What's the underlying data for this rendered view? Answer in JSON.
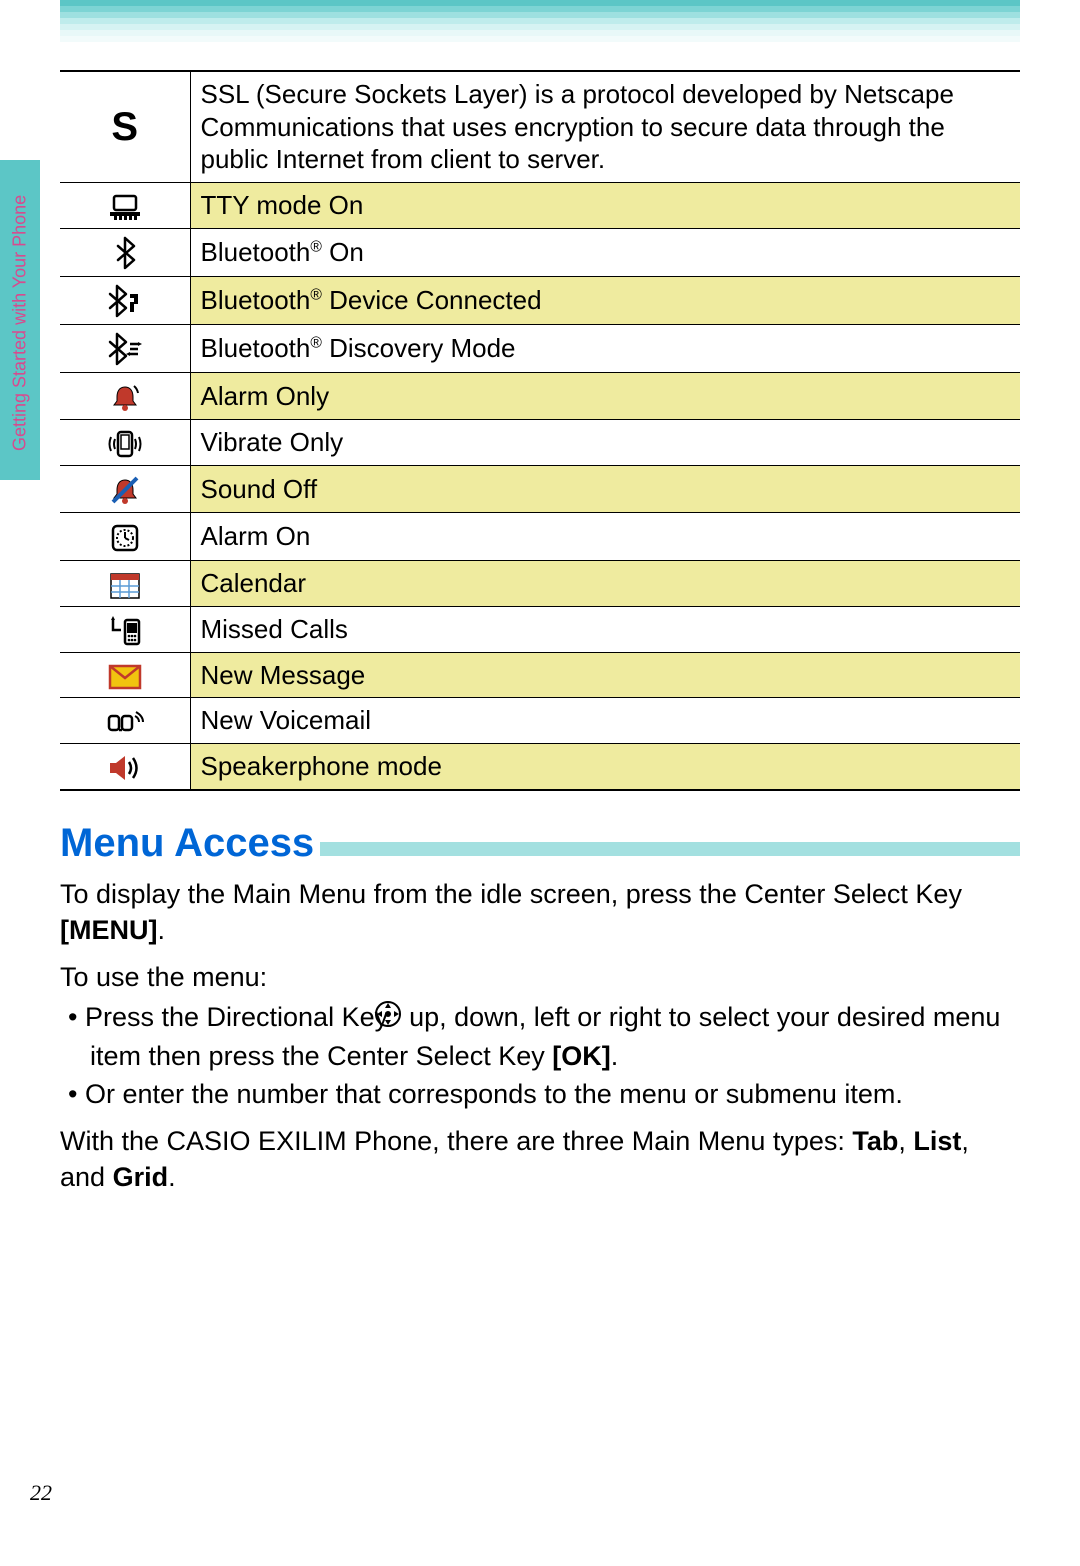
{
  "side_label": "Getting Started with Your Phone",
  "table": {
    "rows": [
      {
        "icon": "ssl-s-icon",
        "desc": "SSL (Secure Sockets Layer) is a protocol developed by Netscape Communications that uses encryption to secure data through the public Internet from client to server.",
        "hl": false
      },
      {
        "icon": "tty-icon",
        "desc": "TTY mode On",
        "hl": true
      },
      {
        "icon": "bluetooth-icon",
        "desc": "Bluetooth® On",
        "hl": false
      },
      {
        "icon": "bluetooth-connected-icon",
        "desc": "Bluetooth® Device Connected",
        "hl": true
      },
      {
        "icon": "bluetooth-discovery-icon",
        "desc": "Bluetooth® Discovery Mode",
        "hl": false
      },
      {
        "icon": "alarm-only-icon",
        "desc": "Alarm Only",
        "hl": true
      },
      {
        "icon": "vibrate-icon",
        "desc": "Vibrate Only",
        "hl": false
      },
      {
        "icon": "sound-off-icon",
        "desc": "Sound Off",
        "hl": true
      },
      {
        "icon": "alarm-on-icon",
        "desc": "Alarm On",
        "hl": false
      },
      {
        "icon": "calendar-icon",
        "desc": "Calendar",
        "hl": true
      },
      {
        "icon": "missed-calls-icon",
        "desc": "Missed Calls",
        "hl": false
      },
      {
        "icon": "new-message-icon",
        "desc": "New Message",
        "hl": true
      },
      {
        "icon": "voicemail-icon",
        "desc": "New Voicemail",
        "hl": false
      },
      {
        "icon": "speakerphone-icon",
        "desc": "Speakerphone mode",
        "hl": true
      }
    ]
  },
  "heading": "Menu Access",
  "para1_a": "To display the Main Menu from the idle screen, press the Center Select Key ",
  "para1_b": "[MENU]",
  "para1_c": ".",
  "para2": "To use the menu:",
  "bullet1_a": "Press the Directional Key ",
  "bullet1_b": " up, down, left or right to select your desired menu item then press the Center Select Key ",
  "bullet1_c": "[OK]",
  "bullet1_d": ".",
  "bullet2": "Or enter the number that corresponds to the menu or submenu item.",
  "para3_a": "With the CASIO EXILIM Phone, there are three Main Menu types: ",
  "para3_b": "Tab",
  "para3_c": ", ",
  "para3_d": "List",
  "para3_e": ", and ",
  "para3_f": "Grid",
  "para3_g": ".",
  "page_number": "22"
}
